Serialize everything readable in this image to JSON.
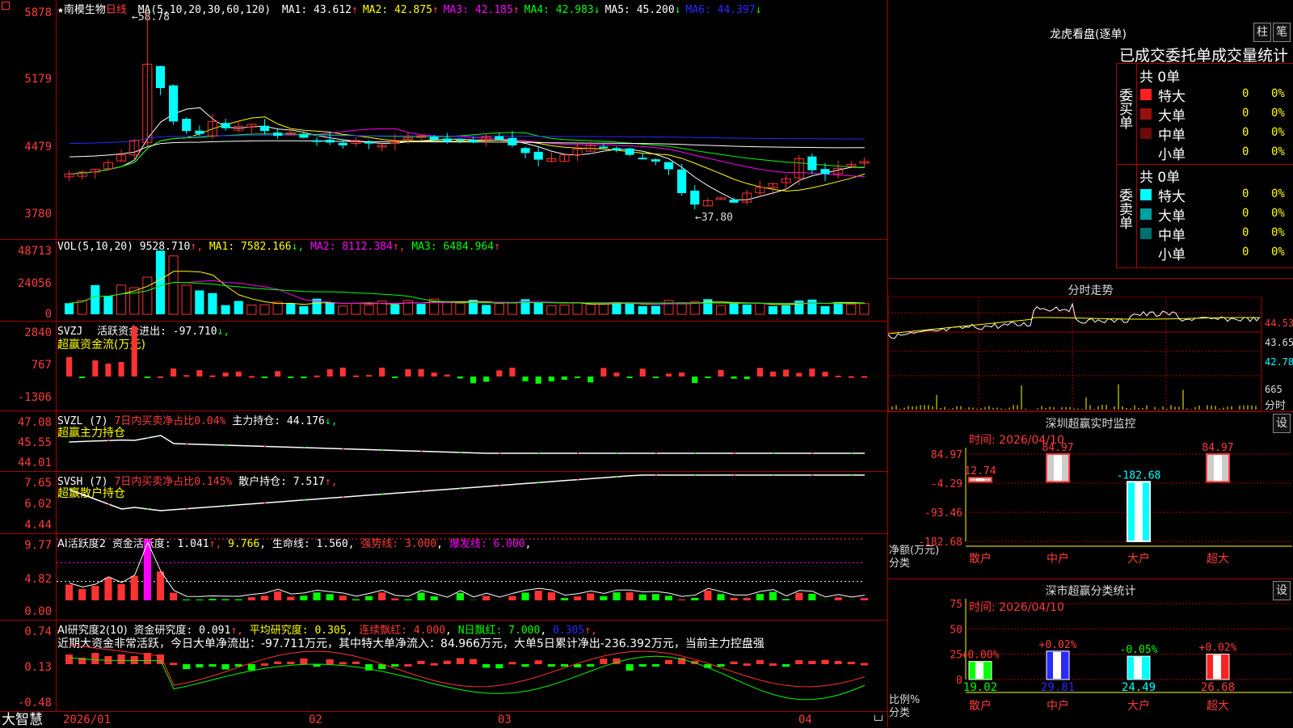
{
  "app": {
    "brand": "大智慧",
    "lock_icon": "lock-icon",
    "corner_icon": "menu-square-icon"
  },
  "colors": {
    "up": "#ff3232",
    "down": "#00ffff",
    "green": "#00ff00",
    "yellow": "#ffff00",
    "magenta": "#ff00ff",
    "blue": "#2a2aff",
    "grid": "#aa0000"
  },
  "main": {
    "star": "★",
    "stock_name": "南模生物",
    "period": "日线",
    "ma_label": "MA(5,10,20,30,60,120)",
    "ma": [
      {
        "label": "MA1: 43.612",
        "arrow": "↑",
        "color": "#ffffff"
      },
      {
        "label": "MA2: 42.875",
        "arrow": "↑",
        "color": "#ffff00"
      },
      {
        "label": "MA3: 42.185",
        "arrow": "↑",
        "color": "#ff00ff"
      },
      {
        "label": "MA4: 42.983",
        "arrow": "↓",
        "color": "#00ff00"
      },
      {
        "label": "MA5: 45.200",
        "arrow": "↓",
        "color": "#ffffff"
      },
      {
        "label": "MA6: 44.397",
        "arrow": "↓",
        "color": "#2a2aff"
      }
    ],
    "high_label": "58.78",
    "low_label": "37.80",
    "y_ticks": [
      "5878",
      "5179",
      "4479",
      "3780"
    ]
  },
  "vol": {
    "title": "VOL(5,10,20)",
    "value": "9528.710",
    "ma1": "MA1: 7582.166",
    "ma2": "MA2: 8112.384",
    "ma3": "MA3: 6484.964",
    "y_ticks": [
      "48713",
      "24056",
      "0"
    ]
  },
  "svzj": {
    "title": "SVZJ",
    "label": "活跃资金进出: -97.710",
    "subtitle": "超赢资金流(万元)",
    "y_ticks": [
      "2840",
      "767",
      "-1306"
    ]
  },
  "svzl": {
    "title": "SVZL (7)",
    "ratio": "7日内买卖净占比0.04%",
    "label": "主力持仓: 44.176",
    "subtitle": "超赢主力持仓",
    "y_ticks": [
      "47.08",
      "45.55",
      "44.01"
    ]
  },
  "svsh": {
    "title": "SVSH (7)",
    "ratio": "7日内买卖净占比0.145%",
    "label": "散户持仓: 7.517",
    "subtitle": "超赢散户持仓",
    "y_ticks": [
      "7.65",
      "6.02",
      "4.44"
    ]
  },
  "ai1": {
    "title": "AI活跃度2",
    "label1": "资金活跃度: 1.041",
    "label2": "9.766",
    "label3": "生命线: 1.560",
    "label4": "强势线: 3.000",
    "label5": "爆发线: 6.000",
    "y_ticks": [
      "9.77",
      "4.82",
      "0.00"
    ]
  },
  "ai2": {
    "title": "AI研究度2(10)",
    "label1": "资金研究度: 0.091",
    "label2": "平均研究度: 0.305",
    "label3": "连续飘红: 4.000",
    "label4": "N日飘红: 7.000",
    "label5": "0.305",
    "summary": "近期大资金非常活跃，今日大单净流出：-97.711万元，其中特大单净流入：84.966万元，大单5日累计净出-236.392万元，当前主力控盘强",
    "y_ticks": [
      "0.74",
      "0.13",
      "-0.48"
    ]
  },
  "x_axis": [
    "2026/01",
    "02",
    "03",
    "04"
  ],
  "longhu": {
    "title": "龙虎看盘(逐单)",
    "btn1": "柱",
    "btn2": "笔",
    "header": "已成交委托单成交量统计",
    "buy_label": "委买单",
    "sell_label": "委卖单",
    "buy_total": "共 0单",
    "sell_total": "共 0单",
    "buy_rows": [
      {
        "name": "特大",
        "count": "0",
        "pct": "0%",
        "color": "#ff2020"
      },
      {
        "name": "大单",
        "count": "0",
        "pct": "0%",
        "color": "#9a1010"
      },
      {
        "name": "中单",
        "count": "0",
        "pct": "0%",
        "color": "#6a0a0a"
      },
      {
        "name": "小单",
        "count": "0",
        "pct": "0%",
        "color": "#000000"
      }
    ],
    "sell_rows": [
      {
        "name": "特大",
        "count": "0",
        "pct": "0%",
        "color": "#00ffff"
      },
      {
        "name": "大单",
        "count": "0",
        "pct": "0%",
        "color": "#00a0a0"
      },
      {
        "name": "中单",
        "count": "0",
        "pct": "0%",
        "color": "#007070"
      },
      {
        "name": "小单",
        "count": "0",
        "pct": "0%",
        "color": "#000000"
      }
    ]
  },
  "fenshi": {
    "title": "分时走势",
    "y_ticks": [
      "44.53",
      "43.65",
      "42.78",
      "665"
    ],
    "right_label": "分时"
  },
  "chart_data": [
    {
      "type": "bar",
      "title": "深圳超赢实时监控",
      "time_label": "时间: 2026/04/10",
      "settings": "设",
      "ylabel": "净额(万元)",
      "xlabel": "分类",
      "categories": [
        "散户",
        "中户",
        "大户",
        "超大"
      ],
      "values": [
        12.74,
        84.97,
        -182.68,
        84.97
      ],
      "value_labels": [
        "12.74",
        "84.97",
        "-182.68",
        "84.97"
      ],
      "y_ticks": [
        "84.97",
        "-4.29",
        "-93.46",
        "-182.68"
      ],
      "ylim": [
        -182.68,
        84.97
      ]
    },
    {
      "type": "bar",
      "title": "深市超赢分类统计",
      "time_label": "时间: 2026/04/10",
      "settings": "设",
      "ylabel": "比例%",
      "xlabel": "分类",
      "categories": [
        "散户",
        "中户",
        "大户",
        "超大"
      ],
      "values": [
        19.02,
        29.81,
        24.49,
        26.68
      ],
      "changes": [
        "+0.00%",
        "+0.02%",
        "-0.05%",
        "+0.02%"
      ],
      "bar_colors": [
        "#00ff00",
        "#2a2aff",
        "#00ffff",
        "#ff2020"
      ],
      "y_ticks": [
        "75",
        "50",
        "25",
        "0"
      ],
      "ylim": [
        0,
        75
      ]
    }
  ]
}
